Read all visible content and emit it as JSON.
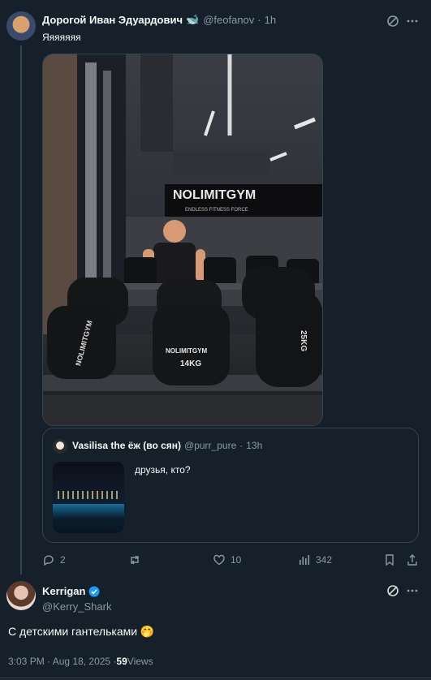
{
  "post1": {
    "author_name": "Дорогой Иван Эдуардович",
    "handle": "@feofanov",
    "time": "1h",
    "text": "Яяяяяяя",
    "photo_signs": {
      "brand": "NOLIMITGYM",
      "tagline": "ENDLESS FITNESS FORCE",
      "dumbbell_left": "NOLIMITGYM",
      "dumbbell_center": "NOLIMITGYM",
      "dumbbell_weight": "14KG",
      "dumbbell_right_weight": "25KG"
    },
    "quote": {
      "author_name": "Vasilisa the ёж (во сян)",
      "handle": "@purr_pure",
      "time": "13h",
      "text": "друзья, кто?"
    },
    "actions": {
      "replies": "2",
      "likes": "10",
      "views": "342"
    }
  },
  "post2": {
    "author_name": "Kerrigan",
    "handle": "@Kerry_Shark",
    "text": "С детскими гантельками 🤭",
    "timestamp": "3:03 PM · Aug 18, 2025 · ",
    "views_count": "59",
    "views_label": " Views"
  },
  "colors": {
    "background": "#15202b",
    "muted": "#8b98a5",
    "verified": "#1d9bf0",
    "border": "#38444d"
  },
  "icons": [
    "whale-emoji",
    "grok-icon",
    "more-icon",
    "reply-icon",
    "retweet-icon",
    "like-icon",
    "views-icon",
    "bookmark-icon",
    "share-icon",
    "verified-badge-icon"
  ]
}
